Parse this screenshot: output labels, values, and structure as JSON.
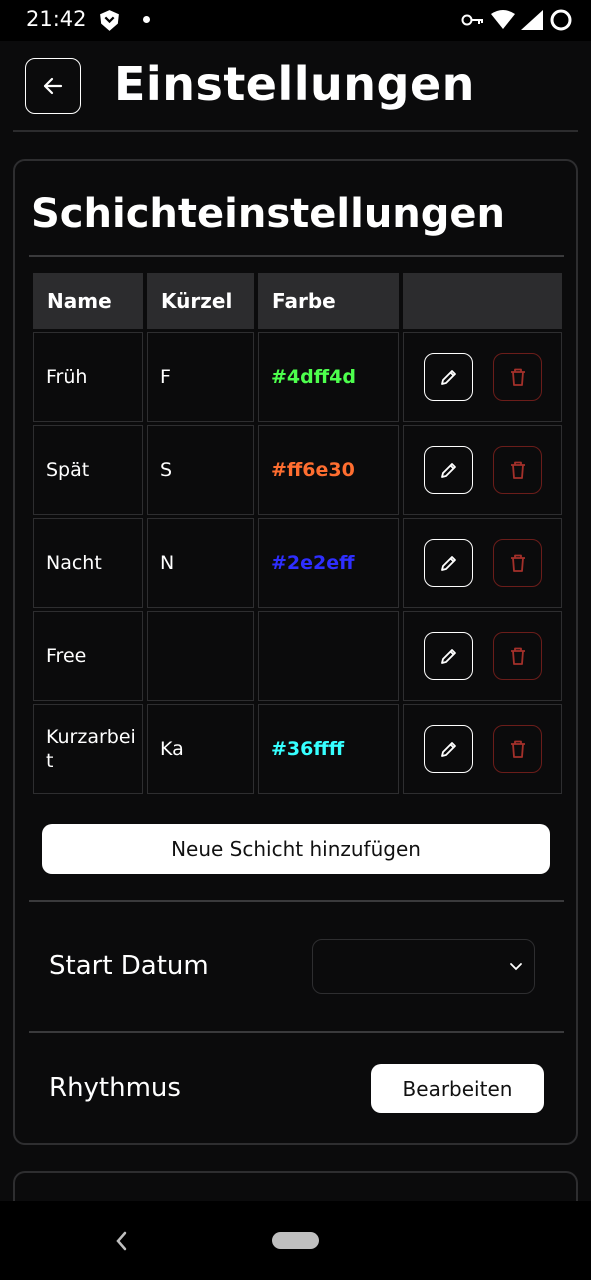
{
  "status_bar": {
    "time": "21:42",
    "icons": [
      "app-shield-icon",
      "notification-dot-icon",
      "vpn-key-icon",
      "wifi-icon",
      "signal-icon",
      "battery-icon"
    ]
  },
  "header": {
    "title": "Einstellungen",
    "back_icon": "arrow-left-icon"
  },
  "shift_settings": {
    "title": "Schichteinstellungen",
    "columns": [
      "Name",
      "Kürzel",
      "Farbe",
      ""
    ],
    "rows": [
      {
        "name": "Früh",
        "abbr": "F",
        "color": "#4dff4d"
      },
      {
        "name": "Spät",
        "abbr": "S",
        "color": "#ff6e30"
      },
      {
        "name": "Nacht",
        "abbr": "N",
        "color": "#2e2eff"
      },
      {
        "name": "Free",
        "abbr": "",
        "color": ""
      },
      {
        "name": "Kurzarbeit",
        "abbr": "Ka",
        "color": "#36ffff"
      }
    ],
    "add_button": "Neue Schicht hinzufügen",
    "start_date": {
      "label": "Start Datum",
      "value": ""
    },
    "rhythm": {
      "label": "Rhythmus",
      "button": "Bearbeiten"
    }
  },
  "colors": {
    "background": "#0b0b0c",
    "header_cell": "#2c2c2e",
    "border": "#2e2e30",
    "delete_border": "#6b1d1a",
    "delete_icon": "#a3302a"
  }
}
